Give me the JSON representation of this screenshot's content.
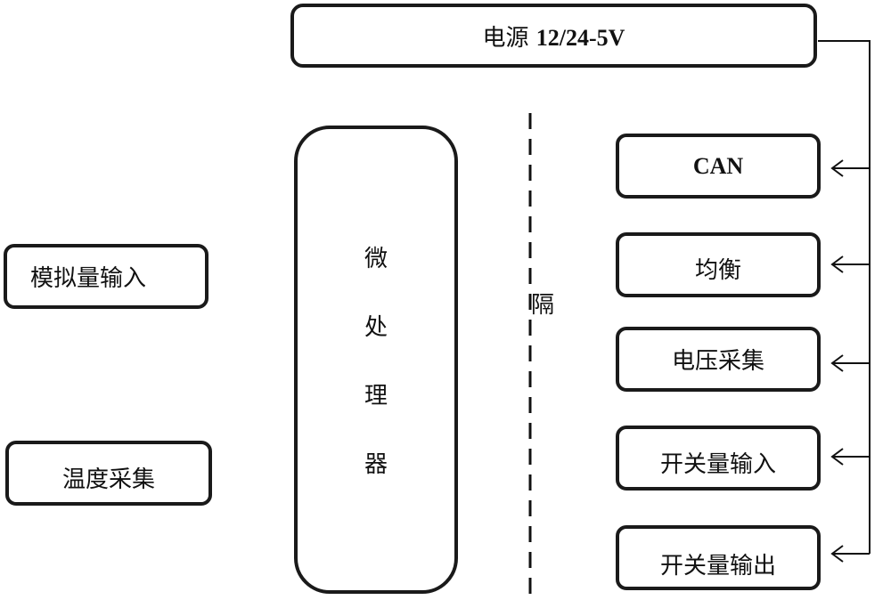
{
  "power_supply": {
    "label_prefix": "电源",
    "label_value": "12/24-5V"
  },
  "microprocessor": {
    "chars": [
      "微",
      "处",
      "理",
      "器"
    ]
  },
  "isolation": {
    "label": "隔"
  },
  "left_modules": [
    {
      "label": "模拟量输入"
    },
    {
      "label": "温度采集"
    }
  ],
  "right_modules": [
    {
      "label": "CAN"
    },
    {
      "label": "均衡"
    },
    {
      "label": "电压采集"
    },
    {
      "label": "开关量输入"
    },
    {
      "label": "开关量输出"
    }
  ]
}
